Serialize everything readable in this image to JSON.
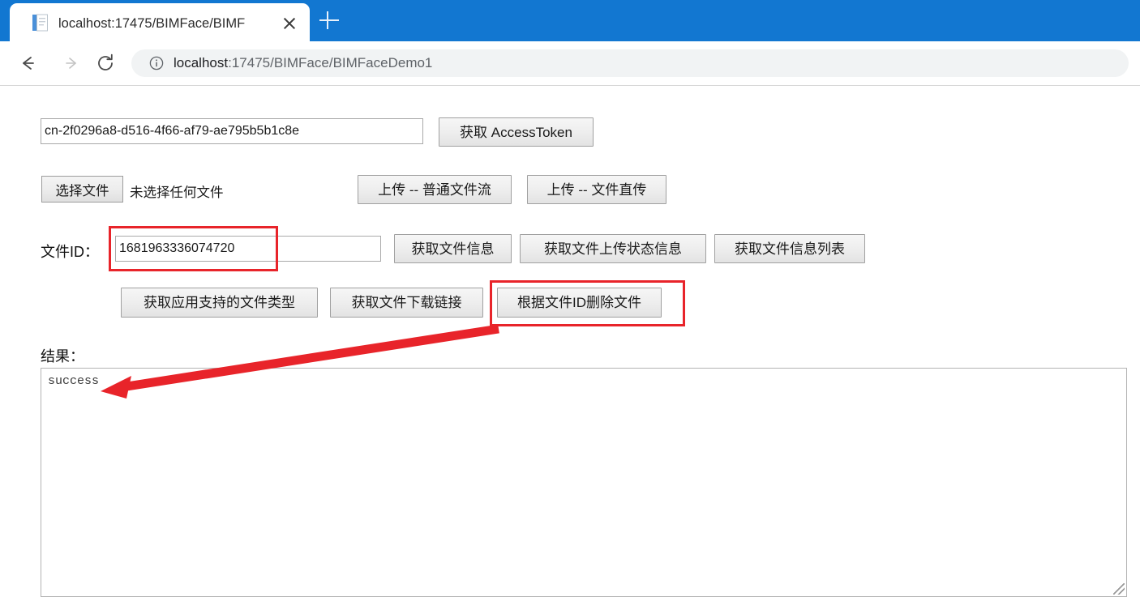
{
  "browser": {
    "tab": {
      "title": "localhost:17475/BIMFace/BIMF",
      "favicon_name": "page-icon",
      "close_label": "×"
    },
    "new_tab_label": "+",
    "nav": {
      "back_label": "←",
      "forward_label": "→",
      "reload_label": "⟳"
    },
    "omnibox": {
      "url_host": "localhost",
      "url_path": ":17475/BIMFace/BIMFaceDemo1",
      "url_full": "localhost:17475/BIMFace/BIMFaceDemo1",
      "info_icon_label": "ⓘ"
    }
  },
  "page": {
    "token_row": {
      "token_value": "cn-2f0296a8-d516-4f66-af79-ae795b5b1c8e",
      "get_token_button": "获取 AccessToken"
    },
    "upload_row": {
      "choose_file_button": "选择文件",
      "no_file_text": "未选择任何文件",
      "upload_stream_button": "上传 -- 普通文件流",
      "upload_direct_button": "上传 -- 文件直传"
    },
    "fileid_row": {
      "label": "文件ID：",
      "file_id_value": "1681963336074720",
      "get_file_info_button": "获取文件信息",
      "get_upload_status_button": "获取文件上传状态信息",
      "get_file_info_list_button": "获取文件信息列表"
    },
    "actions_row": {
      "supported_types_button": "获取应用支持的文件类型",
      "download_link_button": "获取文件下载链接",
      "delete_by_id_button": "根据文件ID删除文件"
    },
    "result": {
      "label": "结果：",
      "text": "success"
    }
  },
  "annotations": {
    "highlight_color": "#e8242a",
    "fileid_box": true,
    "delete_button_box": true,
    "arrow_from_delete_to_result": true
  }
}
